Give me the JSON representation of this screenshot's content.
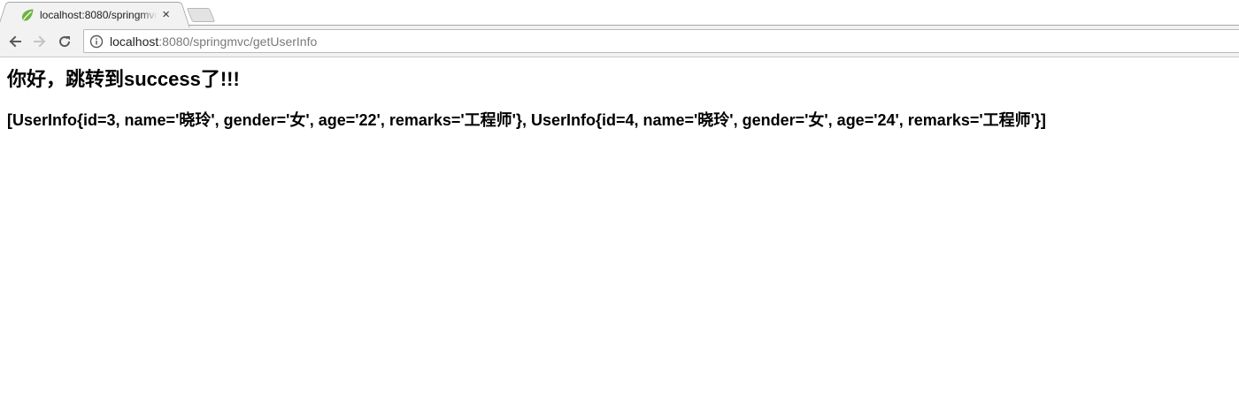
{
  "browser": {
    "tab": {
      "title": "localhost:8080/springmvc/getUserInfo",
      "close_label": "×",
      "favicon": "spring-leaf-icon"
    },
    "address": {
      "host": "localhost",
      "rest": ":8080/springmvc/getUserInfo"
    },
    "icons": {
      "back": "back-arrow-icon",
      "forward": "forward-arrow-icon",
      "reload": "reload-icon",
      "info": "info-icon"
    },
    "colors": {
      "favicon": "#6db33f",
      "active_icon": "#5a5a5a",
      "disabled_icon": "#c4c4c4"
    }
  },
  "page": {
    "heading": "你好，跳转到success了!!!",
    "users_text": "[UserInfo{id=3, name='晓玲', gender='女', age='22', remarks='工程师'}, UserInfo{id=4, name='晓玲', gender='女', age='24', remarks='工程师'}]"
  }
}
